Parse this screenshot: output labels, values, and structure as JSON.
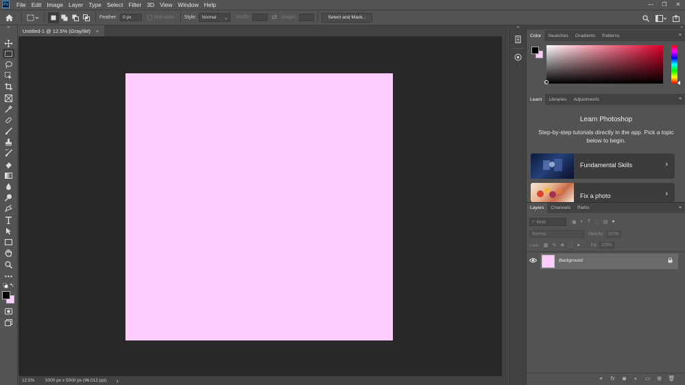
{
  "menubar": {
    "app_icon": "Ps",
    "items": [
      "File",
      "Edit",
      "Image",
      "Layer",
      "Type",
      "Select",
      "Filter",
      "3D",
      "View",
      "Window",
      "Help"
    ],
    "window_controls": [
      "minimize-icon",
      "restore-icon",
      "close-icon"
    ]
  },
  "options": {
    "feather_label": "Feather:",
    "feather_value": "0 px",
    "antialias_label": "Anti-alias",
    "style_label": "Style:",
    "style_value": "Normal",
    "width_label": "Width:",
    "height_label": "Height:",
    "select_mask_label": "Select and Mask..."
  },
  "document": {
    "tab_title": "Untitled-1 @ 12.5% (Gray/8#)",
    "tab_close": "×",
    "canvas_color": "#ffccff",
    "zoom": "12.5%",
    "doc_info": "5000 px x 5000 px (96.012 ppi)",
    "status_arrow": "›"
  },
  "color_panel": {
    "tabs": [
      "Color",
      "Swatches",
      "Gradients",
      "Patterns"
    ],
    "foreground": "#000000",
    "background": "#ffccff"
  },
  "learn_panel": {
    "tabs": [
      "Learn",
      "Libraries",
      "Adjustments"
    ],
    "title": "Learn Photoshop",
    "description": "Step-by-step tutorials directly in the app. Pick a topic below to begin.",
    "cards": [
      {
        "label": "Fundamental Skills",
        "arrow": "›"
      },
      {
        "label": "Fix a photo",
        "arrow": "›"
      }
    ]
  },
  "layers_panel": {
    "tabs": [
      "Layers",
      "Channels",
      "Paths"
    ],
    "kind_placeholder": "Kind",
    "blend_mode": "Normal",
    "opacity_label": "Opacity:",
    "opacity_value": "100%",
    "lock_label": "Lock:",
    "fill_label": "Fill:",
    "fill_value": "100%",
    "layers": [
      {
        "name": "Background",
        "visible": true,
        "locked": true
      }
    ]
  }
}
